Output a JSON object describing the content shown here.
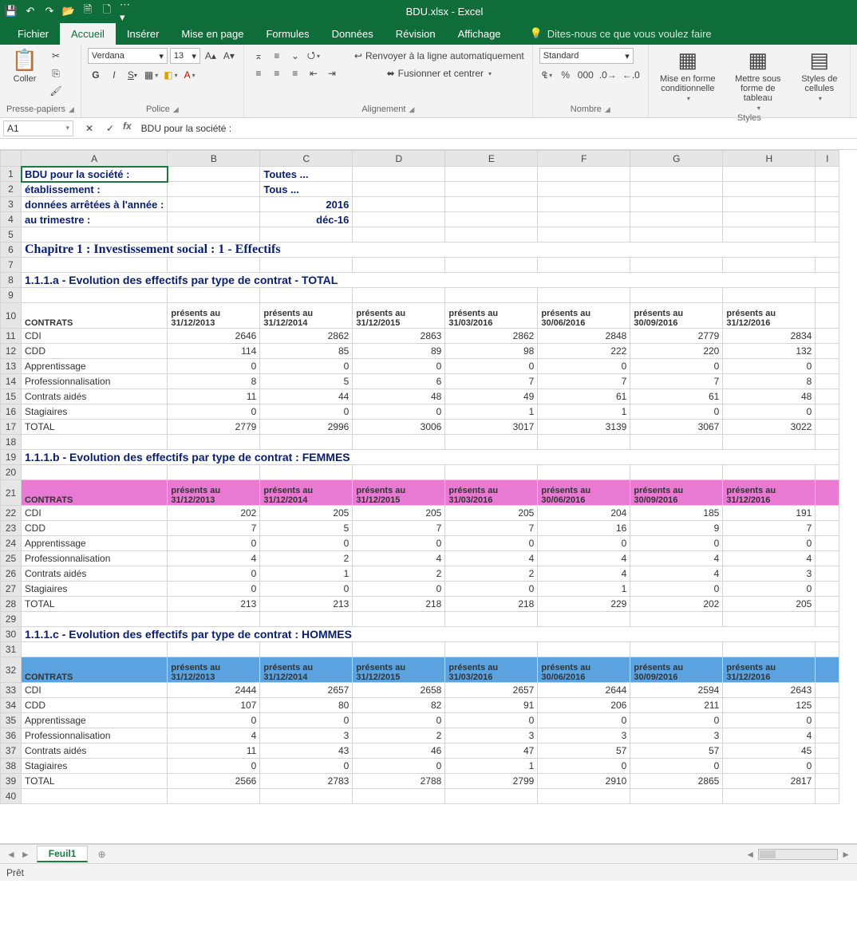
{
  "titlebar": {
    "title": "BDU.xlsx - Excel"
  },
  "tabs": {
    "fichier": "Fichier",
    "accueil": "Accueil",
    "inserer": "Insérer",
    "mise_en_page": "Mise en page",
    "formules": "Formules",
    "donnees": "Données",
    "revision": "Révision",
    "affichage": "Affichage",
    "tell_me": "Dites-nous ce que vous voulez faire"
  },
  "ribbon": {
    "clipboard": {
      "paste": "Coller",
      "label": "Presse-papiers"
    },
    "font": {
      "name": "Verdana",
      "size": "13",
      "label": "Police"
    },
    "align": {
      "wrap": "Renvoyer à la ligne automatiquement",
      "merge": "Fusionner et centrer",
      "label": "Alignement"
    },
    "number": {
      "format": "Standard",
      "label": "Nombre"
    },
    "styles": {
      "cond": "Mise en forme conditionnelle",
      "table": "Mettre sous forme de tableau",
      "cell": "Styles de cellules",
      "label": "Styles"
    }
  },
  "formula": {
    "cell_ref": "A1",
    "text": "BDU pour la société :"
  },
  "sheet": {
    "name": "Feuil1"
  },
  "status": {
    "ready": "Prêt"
  },
  "cols": [
    "A",
    "B",
    "C",
    "D",
    "E",
    "F",
    "G",
    "H",
    "I"
  ],
  "top_rows": [
    {
      "n": 1,
      "a": "BDU pour la société :",
      "c": "Toutes ...",
      "navy": true
    },
    {
      "n": 2,
      "a": "établissement :",
      "c": "Tous ...",
      "navy": true
    },
    {
      "n": 3,
      "a": "données arrêtées à l'année :",
      "c": "2016",
      "navy": true,
      "cnum": true
    },
    {
      "n": 4,
      "a": "au trimestre :",
      "c": "déc-16",
      "navy": true,
      "cnum": true
    }
  ],
  "chapter": {
    "row": 6,
    "text": "Chapitre 1 : Investissement social : 1 - Effectifs"
  },
  "tables": [
    {
      "title_row": 8,
      "title": "1.1.1.a - Evolution des effectifs par type de contrat - TOTAL",
      "header_row": 10,
      "header_style": "plain",
      "blank_after_title": 9,
      "label": "CONTRATS",
      "headers": [
        "présents au 31/12/2013",
        "présents au 31/12/2014",
        "présents au 31/12/2015",
        "présents au 31/03/2016",
        "présents au 30/06/2016",
        "présents au 30/09/2016",
        "présents au 31/12/2016"
      ],
      "rows": [
        {
          "n": 11,
          "l": "CDI",
          "v": [
            2646,
            2862,
            2863,
            2862,
            2848,
            2779,
            2834
          ]
        },
        {
          "n": 12,
          "l": "CDD",
          "v": [
            114,
            85,
            89,
            98,
            222,
            220,
            132
          ]
        },
        {
          "n": 13,
          "l": "Apprentissage",
          "v": [
            0,
            0,
            0,
            0,
            0,
            0,
            0
          ]
        },
        {
          "n": 14,
          "l": "Professionnalisation",
          "v": [
            8,
            5,
            6,
            7,
            7,
            7,
            8
          ]
        },
        {
          "n": 15,
          "l": "Contrats aidés",
          "v": [
            11,
            44,
            48,
            49,
            61,
            61,
            48
          ]
        },
        {
          "n": 16,
          "l": "Stagiaires",
          "v": [
            0,
            0,
            0,
            1,
            1,
            0,
            0
          ]
        },
        {
          "n": 17,
          "l": "TOTAL",
          "v": [
            2779,
            2996,
            3006,
            3017,
            3139,
            3067,
            3022
          ]
        }
      ],
      "blank_after": 18
    },
    {
      "title_row": 19,
      "title": "1.1.1.b - Evolution des effectifs par type de contrat : FEMMES",
      "header_row": 21,
      "header_style": "pink",
      "blank_after_title": 20,
      "label": "CONTRATS",
      "headers": [
        "présents au 31/12/2013",
        "présents au 31/12/2014",
        "présents au 31/12/2015",
        "présents au 31/03/2016",
        "présents au 30/06/2016",
        "présents au 30/09/2016",
        "présents au 31/12/2016"
      ],
      "rows": [
        {
          "n": 22,
          "l": "CDI",
          "v": [
            202,
            205,
            205,
            205,
            204,
            185,
            191
          ]
        },
        {
          "n": 23,
          "l": "CDD",
          "v": [
            7,
            5,
            7,
            7,
            16,
            9,
            7
          ]
        },
        {
          "n": 24,
          "l": "Apprentissage",
          "v": [
            0,
            0,
            0,
            0,
            0,
            0,
            0
          ]
        },
        {
          "n": 25,
          "l": "Professionnalisation",
          "v": [
            4,
            2,
            4,
            4,
            4,
            4,
            4
          ]
        },
        {
          "n": 26,
          "l": "Contrats aidés",
          "v": [
            0,
            1,
            2,
            2,
            4,
            4,
            3
          ]
        },
        {
          "n": 27,
          "l": "Stagiaires",
          "v": [
            0,
            0,
            0,
            0,
            1,
            0,
            0
          ]
        },
        {
          "n": 28,
          "l": "TOTAL",
          "v": [
            213,
            213,
            218,
            218,
            229,
            202,
            205
          ]
        }
      ],
      "blank_after": 29
    },
    {
      "title_row": 30,
      "title": "1.1.1.c - Evolution des effectifs par type de contrat : HOMMES",
      "header_row": 32,
      "header_style": "blue",
      "blank_after_title": 31,
      "label": "CONTRATS",
      "headers": [
        "présents au 31/12/2013",
        "présents au 31/12/2014",
        "présents au 31/12/2015",
        "présents au 31/03/2016",
        "présents au 30/06/2016",
        "présents au 30/09/2016",
        "présents au 31/12/2016"
      ],
      "rows": [
        {
          "n": 33,
          "l": "CDI",
          "v": [
            2444,
            2657,
            2658,
            2657,
            2644,
            2594,
            2643
          ]
        },
        {
          "n": 34,
          "l": "CDD",
          "v": [
            107,
            80,
            82,
            91,
            206,
            211,
            125
          ]
        },
        {
          "n": 35,
          "l": "Apprentissage",
          "v": [
            0,
            0,
            0,
            0,
            0,
            0,
            0
          ]
        },
        {
          "n": 36,
          "l": "Professionnalisation",
          "v": [
            4,
            3,
            2,
            3,
            3,
            3,
            4
          ]
        },
        {
          "n": 37,
          "l": "Contrats aidés",
          "v": [
            11,
            43,
            46,
            47,
            57,
            57,
            45
          ]
        },
        {
          "n": 38,
          "l": "Stagiaires",
          "v": [
            0,
            0,
            0,
            1,
            0,
            0,
            0
          ]
        },
        {
          "n": 39,
          "l": "TOTAL",
          "v": [
            2566,
            2783,
            2788,
            2799,
            2910,
            2865,
            2817
          ]
        }
      ],
      "blank_after": 40
    }
  ]
}
